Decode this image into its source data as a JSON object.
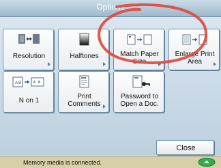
{
  "window": {
    "title": "Options"
  },
  "tiles": [
    {
      "label": "Resolution",
      "icon": "resolution-icon"
    },
    {
      "label": "Halftones",
      "icon": "halftones-icon"
    },
    {
      "label": "Match Paper\nSize",
      "icon": "match-paper-size-icon"
    },
    {
      "label": "Enlarge Print\nArea",
      "icon": "enlarge-print-area-icon"
    },
    {
      "label": "N on 1",
      "icon": "n-on-1-icon"
    },
    {
      "label": "Print\nComments",
      "icon": "print-comments-icon"
    },
    {
      "label": "Password to\nOpen a Doc.",
      "icon": "password-icon"
    }
  ],
  "footer": {
    "close_label": "Close",
    "status_text": "Memory media is connected."
  },
  "colors": {
    "annotation": "#e04a3f",
    "status_led": "#2fb04a"
  }
}
